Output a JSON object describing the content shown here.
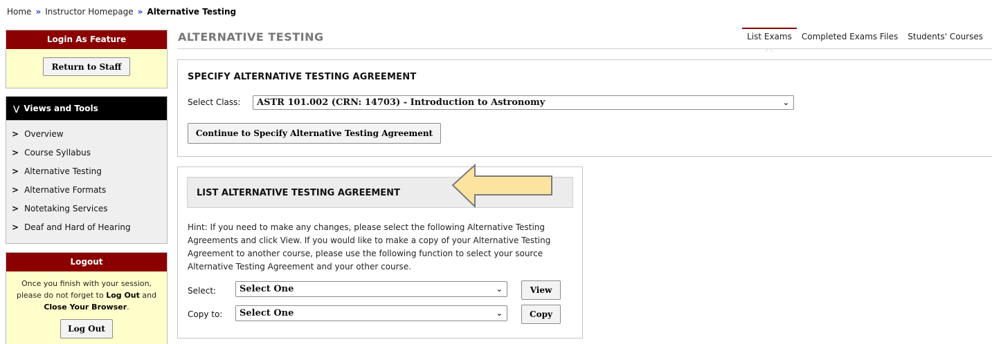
{
  "breadcrumb": {
    "items": [
      "Home",
      "Instructor Homepage"
    ],
    "current": "Alternative Testing",
    "separator": "»"
  },
  "sidebar": {
    "login_feature": {
      "title": "Login As Feature",
      "button": "Return to Staff"
    },
    "views_tools": {
      "title": "Views and Tools",
      "toggle_glyph": "¥",
      "items": [
        {
          "label": "Overview"
        },
        {
          "label": "Course Syllabus"
        },
        {
          "label": "Alternative Testing"
        },
        {
          "label": "Alternative Formats"
        },
        {
          "label": "Notetaking Services"
        },
        {
          "label": "Deaf and Hard of Hearing"
        }
      ]
    },
    "logout": {
      "title": "Logout",
      "text_part1": "Once you finish with your session, please do not forget to ",
      "text_bold1": "Log Out",
      "text_part2": " and ",
      "text_bold2": "Close Your Browser",
      "text_part3": ".",
      "button": "Log Out"
    }
  },
  "main": {
    "title": "ALTERNATIVE TESTING",
    "tabs": [
      {
        "label": "List Exams",
        "active": true
      },
      {
        "label": "Completed Exams Files",
        "active": false
      },
      {
        "label": "Students' Courses",
        "active": false
      }
    ],
    "specify_panel": {
      "heading": "SPECIFY ALTERNATIVE TESTING AGREEMENT",
      "select_label": "Select Class:",
      "select_value": "ASTR 101.002 (CRN: 14703) - Introduction to Astronomy",
      "button": "Continue to Specify Alternative Testing Agreement"
    },
    "list_panel": {
      "heading": "LIST ALTERNATIVE TESTING AGREEMENT",
      "hint": "Hint: If you need to make any changes, please select the following Alternative Testing Agreements and click View. If you would like to make a copy of your Alternative Testing Agreement to another course, please use the following function to select your source Alternative Testing Agreement and your other course.",
      "select_label": "Select:",
      "select_value": "Select One",
      "view_button": "View",
      "copy_label": "Copy to:",
      "copy_value": "Select One",
      "copy_button": "Copy"
    }
  },
  "colors": {
    "header_red": "#8b0000",
    "sidebar_yellow": "#ffffcc",
    "arrow_fill": "#fce4a0",
    "arrow_stroke": "#7a7a7a"
  },
  "icons": {
    "breadcrumb_separator": "double-chevron-right-icon",
    "views_toggle": "double-chevron-down-icon",
    "list_bullet": "chevron-right-icon",
    "select_arrow": "chevron-down-icon",
    "annotation": "arrow-left-annotation"
  }
}
